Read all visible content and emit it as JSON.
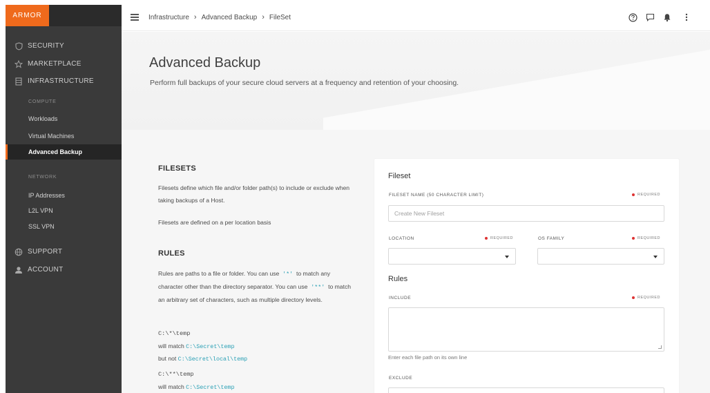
{
  "brand": {
    "logo_text": "ARMOR",
    "accent": "#ef6a1c"
  },
  "sidebar": {
    "sections": [
      {
        "label": "SECURITY",
        "icon": "shield-icon"
      },
      {
        "label": "MARKETPLACE",
        "icon": "star-icon"
      },
      {
        "label": "INFRASTRUCTURE",
        "icon": "server-icon"
      }
    ],
    "compute_label": "COMPUTE",
    "compute_items": [
      "Workloads",
      "Virtual Machines",
      "Advanced Backup"
    ],
    "network_label": "NETWORK",
    "network_items": [
      "IP Addresses",
      "L2L VPN",
      "SSL VPN"
    ],
    "bottom_sections": [
      {
        "label": "SUPPORT",
        "icon": "globe-icon"
      },
      {
        "label": "ACCOUNT",
        "icon": "user-icon"
      }
    ]
  },
  "topbar": {
    "breadcrumb": [
      "Infrastructure",
      "Advanced Backup",
      "FileSet"
    ],
    "icons": [
      "help-icon",
      "chat-icon",
      "bell-icon",
      "more-icon"
    ]
  },
  "hero": {
    "title": "Advanced Backup",
    "subtitle": "Perform full backups of your secure cloud servers at a frequency and retention of your choosing."
  },
  "info": {
    "filesets_heading": "FILESETS",
    "filesets_p1": "Filesets define which file and/or folder path(s) to include or exclude when taking backups of a Host.",
    "filesets_p2": "Filesets are defined on a per location basis",
    "rules_heading": "RULES",
    "rules_p1_a": "Rules are paths to a file or folder. You can use",
    "rules_p1_code1": "'*'",
    "rules_p1_b": "to match any character other than the directory separator. You can use",
    "rules_p1_code2": "'**'",
    "rules_p1_c": "to match an arbitrary set of characters, such as multiple directory levels.",
    "ex1_pattern": "C:\\*\\temp",
    "ex1_match_label": "will match",
    "ex1_match_path": "C:\\Secret\\temp",
    "ex1_not_label": "but not",
    "ex1_not_path": "C:\\Secret\\local\\temp",
    "ex2_pattern": "C:\\**\\temp",
    "ex2_match_label": "will match",
    "ex2_match_path": "C:\\Secret\\temp"
  },
  "form": {
    "fileset_heading": "Fileset",
    "name_label": "FILESET NAME (50 CHARACTER LIMIT)",
    "required": "REQUIRED",
    "name_placeholder": "Create New Fileset",
    "location_label": "LOCATION",
    "os_family_label": "OS FAMILY",
    "location_value": "",
    "os_family_value": "",
    "rules_heading": "Rules",
    "include_label": "INCLUDE",
    "include_value": "",
    "include_helper": "Enter each file path on its own line",
    "exclude_label": "EXCLUDE"
  }
}
